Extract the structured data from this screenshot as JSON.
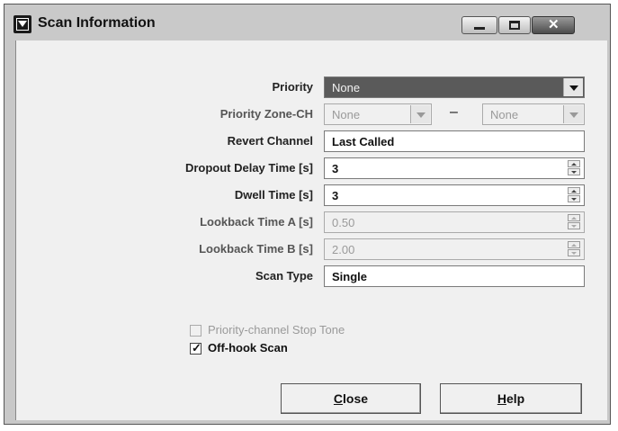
{
  "window": {
    "title": "Scan Information"
  },
  "fields": {
    "priority": {
      "label": "Priority",
      "value": "None"
    },
    "priority_zone_ch": {
      "label": "Priority Zone-CH",
      "value_a": "None",
      "separator": "–",
      "value_b": "None"
    },
    "revert_channel": {
      "label": "Revert Channel",
      "value": "Last Called"
    },
    "dropout_delay_time": {
      "label": "Dropout Delay Time [s]",
      "value": "3"
    },
    "dwell_time": {
      "label": "Dwell Time [s]",
      "value": "3"
    },
    "lookback_time_a": {
      "label": "Lookback Time A [s]",
      "value": "0.50"
    },
    "lookback_time_b": {
      "label": "Lookback Time B [s]",
      "value": "2.00"
    },
    "scan_type": {
      "label": "Scan Type",
      "value": "Single"
    }
  },
  "checkboxes": {
    "priority_stop_tone": {
      "label": "Priority-channel Stop Tone",
      "checked": false,
      "enabled": false
    },
    "off_hook_scan": {
      "label": "Off-hook Scan",
      "checked": true,
      "enabled": true
    }
  },
  "buttons": {
    "close_mnemonic": "C",
    "close_rest": "lose",
    "help_mnemonic": "H",
    "help_rest": "elp"
  },
  "icons": {
    "app": "window-menu-icon",
    "minimize": "minimize-icon",
    "maximize": "maximize-icon",
    "close": "close-icon",
    "check": "✓"
  }
}
